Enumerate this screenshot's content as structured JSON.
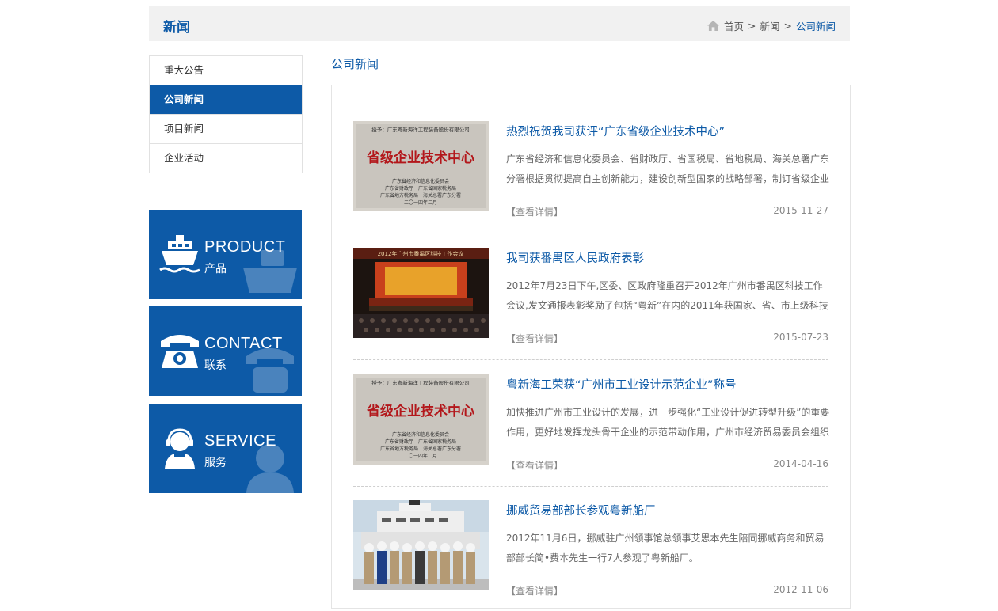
{
  "header": {
    "title": "新闻",
    "breadcrumb": {
      "home": "首页",
      "sep1": ">",
      "news": "新闻",
      "sep2": ">",
      "current": "公司新闻"
    }
  },
  "sidebar": {
    "menu": [
      {
        "label": "重大公告",
        "active": false
      },
      {
        "label": "公司新闻",
        "active": true
      },
      {
        "label": "项目新闻",
        "active": false
      },
      {
        "label": "企业活动",
        "active": false
      }
    ],
    "blocks": [
      {
        "en": "PRODUCT",
        "cn": "产品",
        "icon": "ship-icon"
      },
      {
        "en": "CONTACT",
        "cn": "联系",
        "icon": "telephone-icon"
      },
      {
        "en": "SERVICE",
        "cn": "服务",
        "icon": "headset-operator-icon"
      }
    ]
  },
  "main": {
    "section_title": "公司新闻",
    "news": [
      {
        "title": "热烈祝贺我司获评“广东省级企业技术中心”",
        "desc": "广东省经济和信息化委员会、省财政厅、省国税局、省地税局、海关总署广东分署根据贯彻提高自主创新能力，建设创新型国家的战略部署，制订省级企业技术",
        "more": "【查看详情】",
        "date": "2015-11-27",
        "image": "plaque",
        "plaque_top": "授予：广东粤新海洋工程装备股份有限公司",
        "plaque_main": "省级企业技术中心",
        "plaque_lines": [
          "广东省经济和信息化委员会",
          "广东省财政厅　广东省国家税务局",
          "广东省地方税务局　海关总署广东分署",
          "二〇一四年二月"
        ]
      },
      {
        "title": "我司获番禺区人民政府表彰",
        "desc": "2012年7月23日下午,区委、区政府隆重召开2012年广州市番禺区科技工作会议,发文通报表彰奖励了包括“粤新”在内的2011年获国家、省、市上级科技资质",
        "more": "【查看详情】",
        "date": "2015-07-23",
        "image": "conference",
        "banner": "2012年广州市番禺区科技工作会议"
      },
      {
        "title": "粤新海工荣获“广州市工业设计示范企业”称号",
        "desc": "加快推进广州市工业设计的发展，进一步强化“工业设计促进转型升级”的重要作用，更好地发挥龙头骨干企业的示范带动作用，广州市经济贸易委员会组织开",
        "more": "【查看详情】",
        "date": "2014-04-16",
        "image": "plaque",
        "plaque_top": "授予：广东粤新海洋工程装备股份有限公司",
        "plaque_main": "省级企业技术中心",
        "plaque_lines": [
          "广东省经济和信息化委员会",
          "广东省财政厅　广东省国家税务局",
          "广东省地方税务局　海关总署广东分署",
          "二〇一四年二月"
        ]
      },
      {
        "title": "挪威贸易部部长参观粤新船厂",
        "desc": "2012年11月6日，挪威驻广州领事馆总领事艾思本先生陪同挪威商务和贸易部部长简•费本先生一行7人参观了粤新船厂。",
        "more": "【查看详情】",
        "date": "2012-11-06",
        "image": "ship-group"
      }
    ]
  },
  "colors": {
    "brand_blue": "#0d5aa7",
    "header_bg": "#f1f1f1"
  }
}
